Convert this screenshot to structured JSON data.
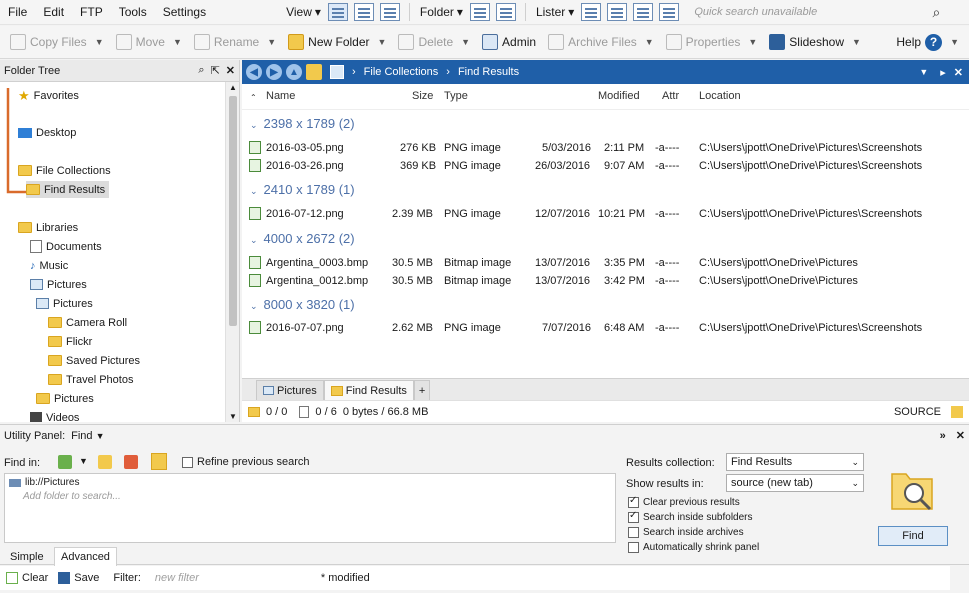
{
  "menu": [
    "File",
    "Edit",
    "FTP",
    "Tools",
    "Settings"
  ],
  "toolbar": {
    "view_label": "View",
    "folder_label": "Folder",
    "lister_label": "Lister",
    "quick_search": "Quick search unavailable"
  },
  "actions": [
    {
      "label": "Copy Files",
      "enabled": false
    },
    {
      "label": "Move",
      "enabled": false
    },
    {
      "label": "Rename",
      "enabled": false
    },
    {
      "label": "New Folder",
      "enabled": true
    },
    {
      "label": "Delete",
      "enabled": false
    },
    {
      "label": "Admin",
      "enabled": true
    },
    {
      "label": "Archive Files",
      "enabled": false
    },
    {
      "label": "Properties",
      "enabled": false
    },
    {
      "label": "Slideshow",
      "enabled": true
    }
  ],
  "help_label": "Help",
  "folder_tree": {
    "title": "Folder Tree",
    "items": [
      {
        "label": "Favorites",
        "level": 0
      },
      {
        "label": "Desktop",
        "level": 0
      },
      {
        "label": "File Collections",
        "level": 0
      },
      {
        "label": "Find Results",
        "level": 1,
        "selected": true
      },
      {
        "label": "Libraries",
        "level": 0
      },
      {
        "label": "Documents",
        "level": 1
      },
      {
        "label": "Music",
        "level": 1
      },
      {
        "label": "Pictures",
        "level": 1
      },
      {
        "label": "Pictures",
        "level": 2
      },
      {
        "label": "Camera Roll",
        "level": 3
      },
      {
        "label": "Flickr",
        "level": 3
      },
      {
        "label": "Saved Pictures",
        "level": 3
      },
      {
        "label": "Travel Photos",
        "level": 3
      },
      {
        "label": "Pictures",
        "level": 2
      },
      {
        "label": "Videos",
        "level": 1
      }
    ]
  },
  "path": {
    "segments": [
      "File Collections",
      "Find Results"
    ]
  },
  "columns": {
    "name": "Name",
    "size": "Size",
    "type": "Type",
    "modified": "Modified",
    "attr": "Attr",
    "location": "Location"
  },
  "groups": [
    {
      "title": "2398 x 1789 (2)",
      "files": [
        {
          "name": "2016-03-05.png",
          "size": "276 KB",
          "type": "PNG image",
          "date": "5/03/2016",
          "time": "2:11 PM",
          "attr": "-a----",
          "location": "C:\\Users\\jpott\\OneDrive\\Pictures\\Screenshots"
        },
        {
          "name": "2016-03-26.png",
          "size": "369 KB",
          "type": "PNG image",
          "date": "26/03/2016",
          "time": "9:07 AM",
          "attr": "-a----",
          "location": "C:\\Users\\jpott\\OneDrive\\Pictures\\Screenshots"
        }
      ]
    },
    {
      "title": "2410 x 1789 (1)",
      "files": [
        {
          "name": "2016-07-12.png",
          "size": "2.39 MB",
          "type": "PNG image",
          "date": "12/07/2016",
          "time": "10:21 PM",
          "attr": "-a----",
          "location": "C:\\Users\\jpott\\OneDrive\\Pictures\\Screenshots"
        }
      ]
    },
    {
      "title": "4000 x 2672 (2)",
      "files": [
        {
          "name": "Argentina_0003.bmp",
          "size": "30.5 MB",
          "type": "Bitmap image",
          "date": "13/07/2016",
          "time": "3:35 PM",
          "attr": "-a----",
          "location": "C:\\Users\\jpott\\OneDrive\\Pictures"
        },
        {
          "name": "Argentina_0012.bmp",
          "size": "30.5 MB",
          "type": "Bitmap image",
          "date": "13/07/2016",
          "time": "3:42 PM",
          "attr": "-a----",
          "location": "C:\\Users\\jpott\\OneDrive\\Pictures"
        }
      ]
    },
    {
      "title": "8000 x 3820 (1)",
      "files": [
        {
          "name": "2016-07-07.png",
          "size": "2.62 MB",
          "type": "PNG image",
          "date": "7/07/2016",
          "time": "6:48 AM",
          "attr": "-a----",
          "location": "C:\\Users\\jpott\\OneDrive\\Pictures\\Screenshots"
        }
      ]
    }
  ],
  "tabs": [
    {
      "label": "Pictures",
      "active": false
    },
    {
      "label": "Find Results",
      "active": true
    }
  ],
  "status": {
    "folders": "0 / 0",
    "files": "0 / 6",
    "bytes": "0 bytes / 66.8 MB",
    "source": "SOURCE"
  },
  "utility": {
    "title": "Utility Panel:",
    "mode": "Find",
    "find_in_label": "Find in:",
    "refine_label": "Refine previous search",
    "locations": [
      "lib://Pictures"
    ],
    "add_folder_hint": "Add folder to search...",
    "results_collection_label": "Results collection:",
    "results_collection_value": "Find Results",
    "show_results_label": "Show results in:",
    "show_results_value": "source (new tab)",
    "options": [
      {
        "label": "Clear previous results",
        "checked": true
      },
      {
        "label": "Search inside subfolders",
        "checked": true
      },
      {
        "label": "Search inside archives",
        "checked": false
      },
      {
        "label": "Automatically shrink panel",
        "checked": false
      }
    ],
    "find_button": "Find",
    "tab_simple": "Simple",
    "tab_advanced": "Advanced",
    "clear_label": "Clear",
    "save_label": "Save",
    "filter_label": "Filter:",
    "filter_placeholder": "new filter",
    "modified_note": "* modified"
  }
}
